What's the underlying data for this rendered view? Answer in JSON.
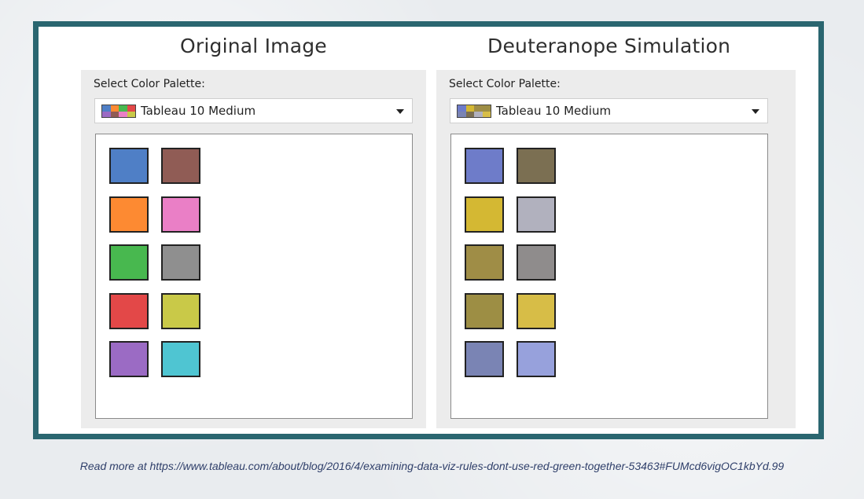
{
  "left_panel": {
    "title": "Original Image",
    "label": "Select Color Palette:",
    "selected_palette": "Tableau 10 Medium",
    "swatches": [
      "#4f7fc6",
      "#905c55",
      "#fd8a32",
      "#ea7fc6",
      "#48b84f",
      "#8f8f8f",
      "#e34848",
      "#c9c948",
      "#9b6bc4",
      "#4fc5d2"
    ],
    "palette_icon_colors": [
      "#4f7fc6",
      "#fd8a32",
      "#48b84f",
      "#e34848",
      "#9b6bc4",
      "#905c55",
      "#ea7fc6",
      "#c9c948"
    ]
  },
  "right_panel": {
    "title": "Deuteranope Simulation",
    "label": "Select Color Palette:",
    "selected_palette": "Tableau 10 Medium",
    "swatches": [
      "#6e7cc9",
      "#7b6f52",
      "#d4b833",
      "#b1b1be",
      "#9f8d46",
      "#8f8c8c",
      "#9d8e44",
      "#d7bd47",
      "#7a84b4",
      "#97a1dc"
    ],
    "palette_icon_colors": [
      "#6e7cc9",
      "#d4b833",
      "#9f8d46",
      "#9d8e44",
      "#7a84b4",
      "#7b6f52",
      "#b1b1be",
      "#d7bd47"
    ]
  },
  "footer": {
    "text": "Read more at https://www.tableau.com/about/blog/2016/4/examining-data-viz-rules-dont-use-red-green-together-53463#FUMcd6vigOC1kbYd.99"
  },
  "colors": {
    "frame_border": "#2a6670",
    "panel_background": "#ececec"
  }
}
